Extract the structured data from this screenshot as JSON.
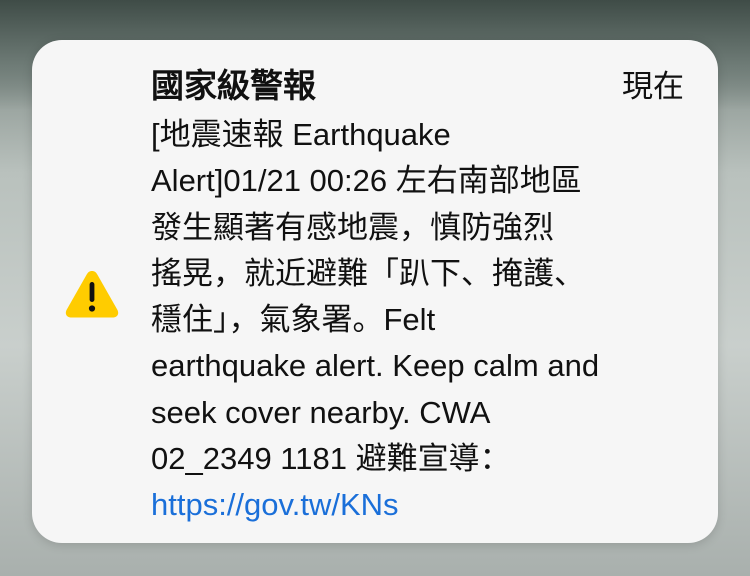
{
  "notification": {
    "title": "國家級警報",
    "time": "現在",
    "lines": [
      "[地震速報 Earthquake",
      "Alert]01/21 00:26 左右南部地區",
      "發生顯著有感地震，慎防強烈",
      "搖晃，就近避難「趴下、掩護、",
      "穩住」，氣象署。Felt",
      "earthquake alert. Keep calm and",
      "seek cover nearby. CWA",
      "02_2349 1181 避難宣導："
    ],
    "link": "https://gov.tw/KNs",
    "icon": "warning-triangle-icon",
    "icon_color": "#ffcc00",
    "link_color": "#1a6fd9"
  }
}
